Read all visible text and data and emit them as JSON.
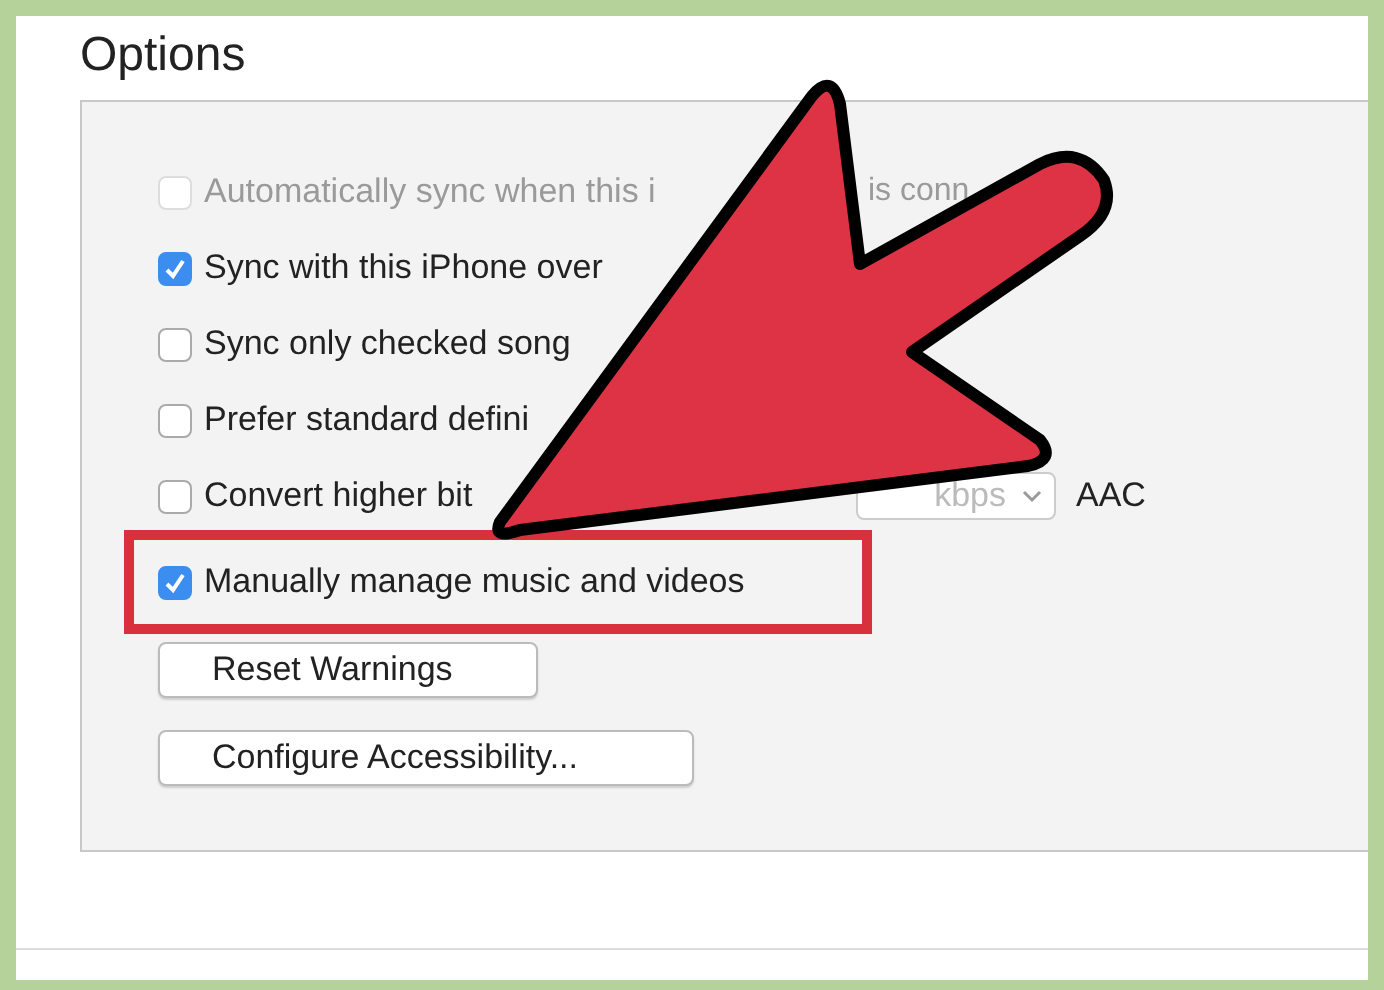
{
  "section": {
    "title": "Options"
  },
  "options": [
    {
      "kind": "checkbox",
      "label": "Automatically sync when this i",
      "tail": "is conn",
      "checked": false,
      "disabled": true,
      "highlighted": false
    },
    {
      "kind": "checkbox",
      "label": "Sync with this iPhone over",
      "checked": true,
      "disabled": false,
      "highlighted": false
    },
    {
      "kind": "checkbox",
      "label": "Sync only checked song",
      "checked": false,
      "disabled": false,
      "highlighted": false
    },
    {
      "kind": "checkbox",
      "label": "Prefer standard defini",
      "checked": false,
      "disabled": false,
      "highlighted": false
    },
    {
      "kind": "convert",
      "label": "Convert higher bit",
      "dropdown": "kbps",
      "format": "AAC",
      "checked": false,
      "disabled": false,
      "highlighted": false
    },
    {
      "kind": "checkbox",
      "label": "Manually manage music and videos",
      "checked": true,
      "disabled": false,
      "highlighted": true
    }
  ],
  "buttons": [
    "Reset Warnings",
    "Configure Accessibility..."
  ]
}
